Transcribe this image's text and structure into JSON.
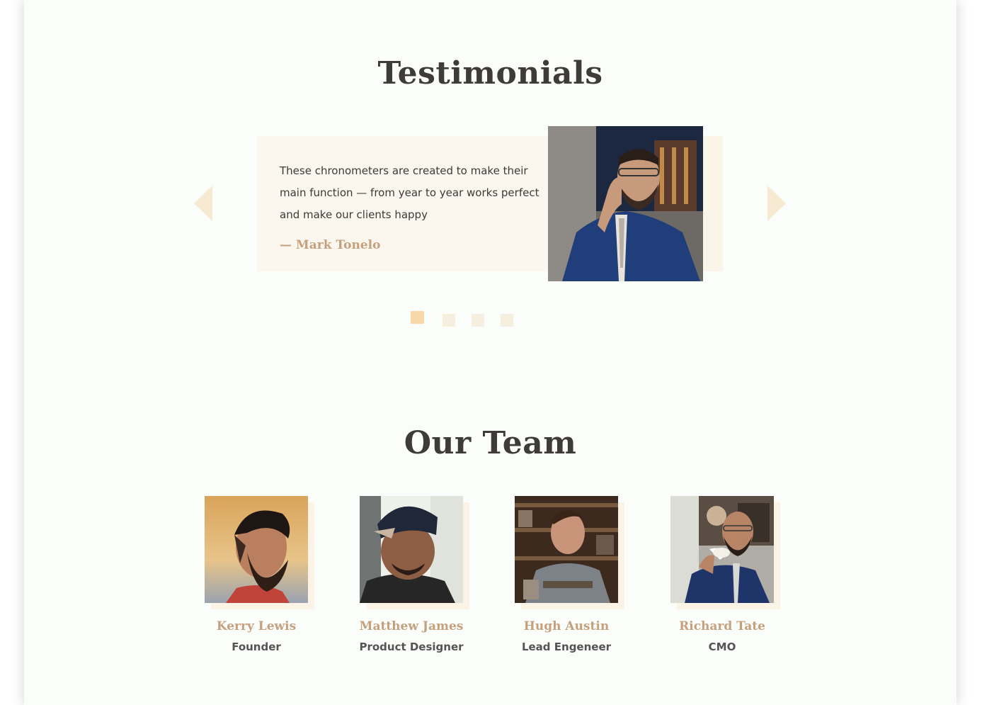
{
  "testimonials": {
    "title": "Testimonials",
    "quote": "These chronometers are created to make their main function — from year to year works perfect and make our clients happy",
    "author": "— Mark Tonelo",
    "dots": 4,
    "active_dot": 1
  },
  "team": {
    "title": "Our Team",
    "members": [
      {
        "name": "Kerry Lewis",
        "role": "Founder"
      },
      {
        "name": "Matthew James",
        "role": "Product Designer"
      },
      {
        "name": "Hugh Austin",
        "role": "Lead Engeneer"
      },
      {
        "name": "Richard Tate",
        "role": "CMO"
      }
    ]
  },
  "colors": {
    "accent": "#c4a07d",
    "heading": "#3f3b3b",
    "card_bg": "#fbf7ee",
    "dot_active": "#f8d8a6",
    "page_bg": "#fbfdfa"
  }
}
